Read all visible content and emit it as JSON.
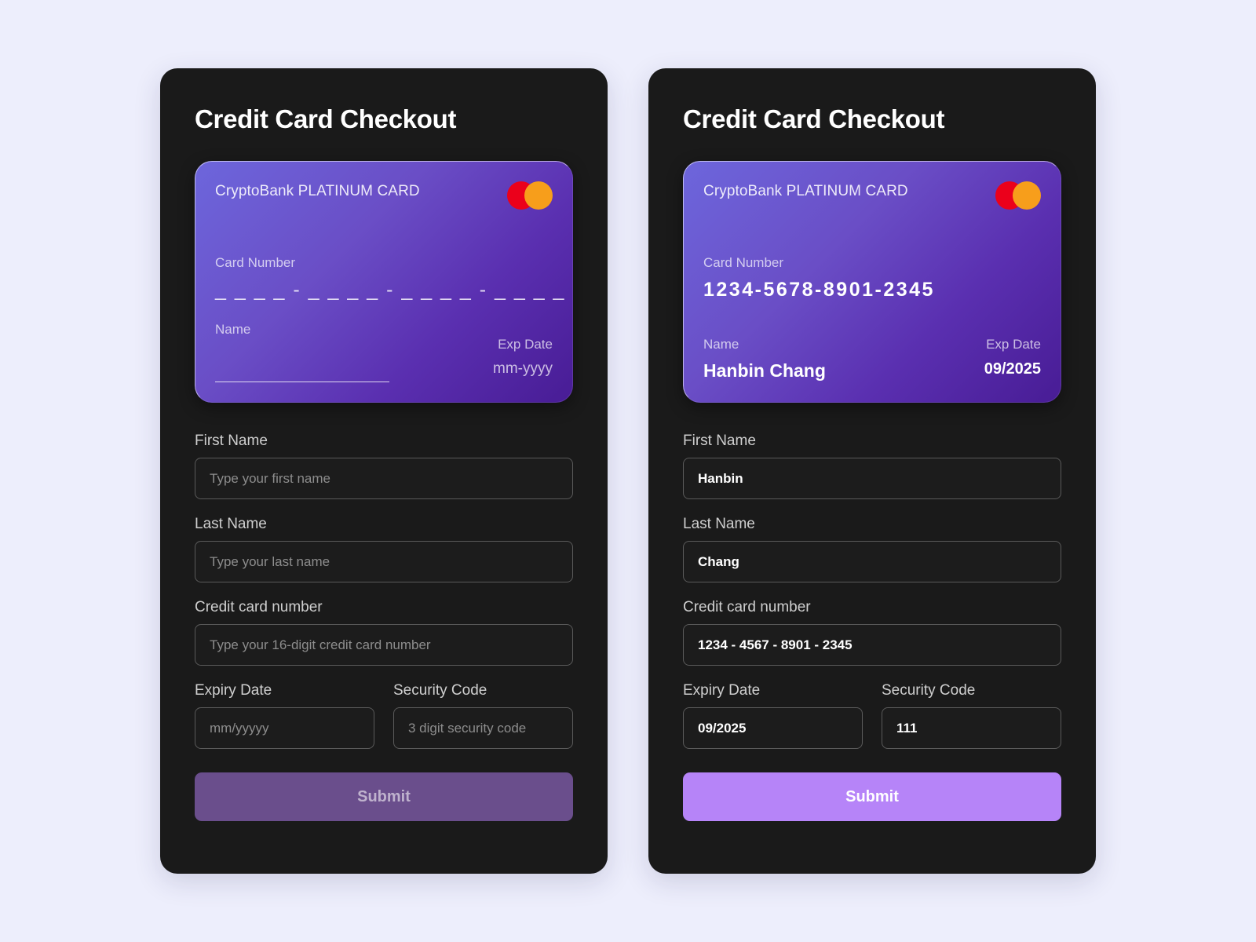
{
  "page": {
    "background_color": "#edeefc"
  },
  "colors": {
    "panel_bg": "#1a1a1a",
    "card_gradient_start": "#6d66dc",
    "card_gradient_end": "#481c95",
    "submit_disabled": "#6a4e8c",
    "submit_active": "#b684f8",
    "mastercard_red": "#eb001b",
    "mastercard_orange": "#f79e1b"
  },
  "panels": [
    {
      "id": "empty-state",
      "title": "Credit Card Checkout",
      "card": {
        "brand": "CryptoBank PLATINUM CARD",
        "logo_icon": "mastercard-icon",
        "number_label": "Card Number",
        "number_value": "_ _ _ _ - _ _ _ _ - _ _ _ _ - _ _ _ _",
        "number_filled": false,
        "name_label": "Name",
        "name_value": "",
        "name_filled": false,
        "exp_label": "Exp Date",
        "exp_value": "mm-yyyy",
        "exp_filled": false
      },
      "form": {
        "first_name": {
          "label": "First Name",
          "value": "",
          "placeholder": "Type your first name"
        },
        "last_name": {
          "label": "Last Name",
          "value": "",
          "placeholder": "Type your last name"
        },
        "card_number": {
          "label": "Credit card number",
          "value": "",
          "placeholder": "Type your 16-digit credit card number"
        },
        "expiry": {
          "label": "Expiry Date",
          "value": "",
          "placeholder": "mm/yyyyy"
        },
        "security_code": {
          "label": "Security Code",
          "value": "",
          "placeholder": "3 digit security code"
        },
        "submit_label": "Submit",
        "submit_enabled": false
      }
    },
    {
      "id": "filled-state",
      "title": "Credit Card Checkout",
      "card": {
        "brand": "CryptoBank PLATINUM CARD",
        "logo_icon": "mastercard-icon",
        "number_label": "Card Number",
        "number_value": "1234-5678-8901-2345",
        "number_filled": true,
        "name_label": "Name",
        "name_value": "Hanbin Chang",
        "name_filled": true,
        "exp_label": "Exp Date",
        "exp_value": "09/2025",
        "exp_filled": true
      },
      "form": {
        "first_name": {
          "label": "First Name",
          "value": "Hanbin",
          "placeholder": "Type your first name"
        },
        "last_name": {
          "label": "Last Name",
          "value": "Chang",
          "placeholder": "Type your last name"
        },
        "card_number": {
          "label": "Credit card number",
          "value": "1234 - 4567 - 8901 - 2345",
          "placeholder": "Type your 16-digit credit card number"
        },
        "expiry": {
          "label": "Expiry Date",
          "value": "09/2025",
          "placeholder": "mm/yyyyy"
        },
        "security_code": {
          "label": "Security Code",
          "value": "111",
          "placeholder": "3 digit security code"
        },
        "submit_label": "Submit",
        "submit_enabled": true
      }
    }
  ]
}
